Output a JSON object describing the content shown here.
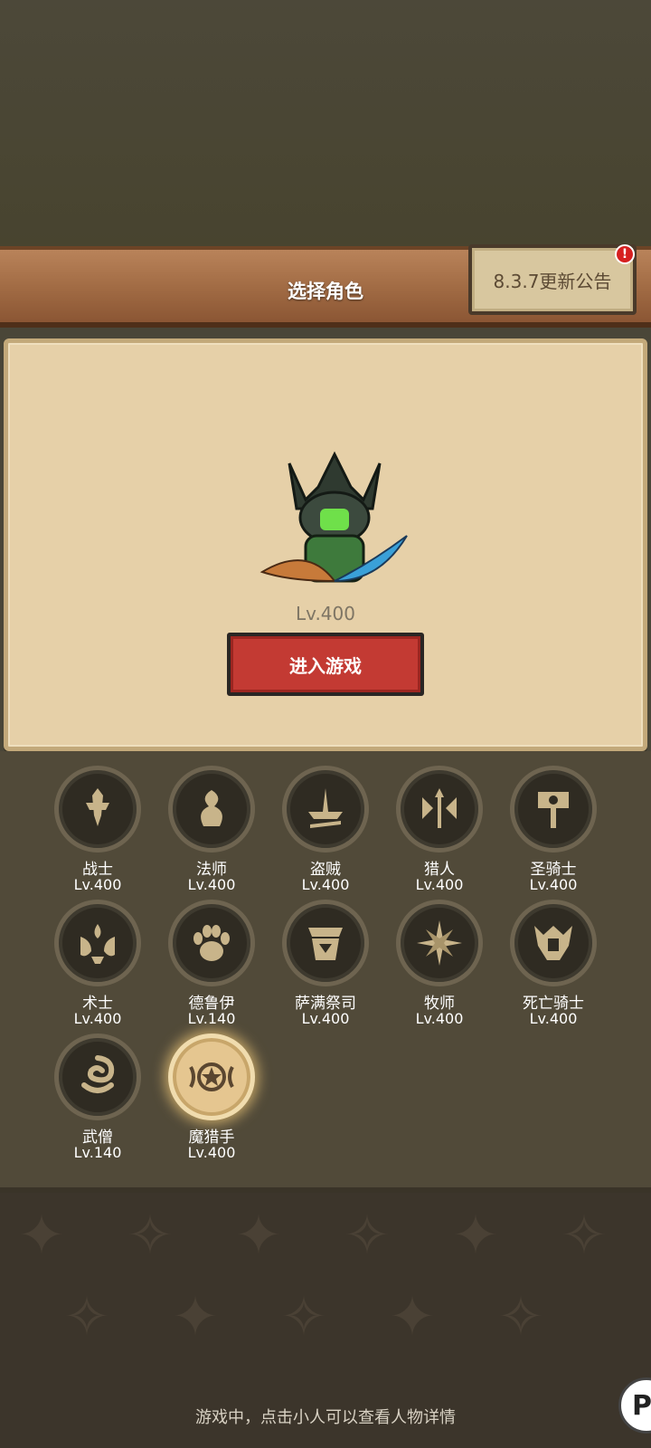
{
  "header": {
    "title": "选择角色",
    "notice_label": "8.3.7更新公告",
    "notice_badge": "!"
  },
  "selected_character": {
    "level": "Lv.400",
    "enter_button": "进入游戏"
  },
  "classes": [
    {
      "name": "战士",
      "level": "Lv.400",
      "icon": "warrior-icon"
    },
    {
      "name": "法师",
      "level": "Lv.400",
      "icon": "mage-icon"
    },
    {
      "name": "盗贼",
      "level": "Lv.400",
      "icon": "rogue-icon"
    },
    {
      "name": "猎人",
      "level": "Lv.400",
      "icon": "hunter-icon"
    },
    {
      "name": "圣骑士",
      "level": "Lv.400",
      "icon": "paladin-icon"
    },
    {
      "name": "术士",
      "level": "Lv.400",
      "icon": "warlock-icon"
    },
    {
      "name": "德鲁伊",
      "level": "Lv.140",
      "icon": "druid-icon"
    },
    {
      "name": "萨满祭司",
      "level": "Lv.400",
      "icon": "shaman-icon"
    },
    {
      "name": "牧师",
      "level": "Lv.400",
      "icon": "priest-icon"
    },
    {
      "name": "死亡骑士",
      "level": "Lv.400",
      "icon": "death-knight-icon"
    },
    {
      "name": "武僧",
      "level": "Lv.140",
      "icon": "monk-icon"
    },
    {
      "name": "魔猎手",
      "level": "Lv.400",
      "icon": "demon-hunter-icon",
      "selected": true
    }
  ],
  "footer": {
    "hint": "游戏中，点击小人可以查看人物详情"
  },
  "colors": {
    "accent_red": "#c33a33",
    "panel": "#e6d0a8",
    "header_wood": "#a06a43"
  }
}
